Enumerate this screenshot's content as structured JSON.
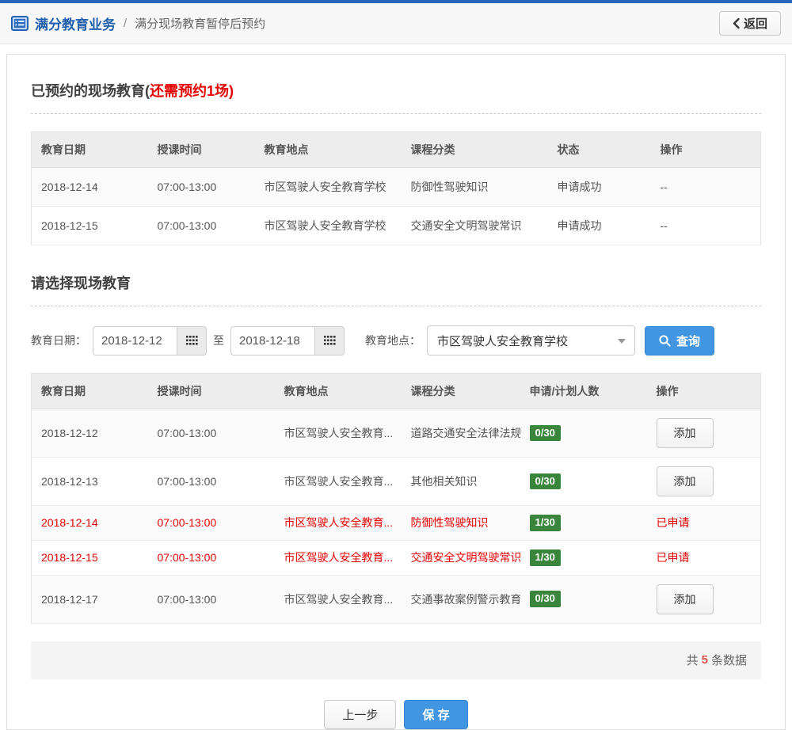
{
  "header": {
    "breadcrumb": {
      "root": "满分教育业务",
      "separator": "/",
      "current": "满分现场教育暂停后预约"
    },
    "back_label": "返回"
  },
  "booked": {
    "title_main": "已预约的现场教育(",
    "title_highlight": "还需预约1场",
    "title_close": ")",
    "table": {
      "headers": [
        "教育日期",
        "授课时间",
        "教育地点",
        "课程分类",
        "状态",
        "操作"
      ],
      "rows": [
        {
          "date": "2018-12-14",
          "time": "07:00-13:00",
          "location": "市区驾驶人安全教育学校",
          "course": "防御性驾驶知识",
          "status": "申请成功",
          "action": "--"
        },
        {
          "date": "2018-12-15",
          "time": "07:00-13:00",
          "location": "市区驾驶人安全教育学校",
          "course": "交通安全文明驾驶常识",
          "status": "申请成功",
          "action": "--"
        }
      ]
    }
  },
  "select": {
    "title": "请选择现场教育",
    "filters": {
      "date_label": "教育日期：",
      "date_from": "2018-12-12",
      "to_label": "至",
      "date_to": "2018-12-18",
      "location_label": "教育地点：",
      "location_value": "市区驾驶人安全教育学校",
      "search_label": "查询"
    },
    "table": {
      "headers": [
        "教育日期",
        "授课时间",
        "教育地点",
        "课程分类",
        "申请/计划人数",
        "操作"
      ],
      "rows": [
        {
          "date": "2018-12-12",
          "time": "07:00-13:00",
          "location": "市区驾驶人安全教育...",
          "course": "道路交通安全法律法规",
          "count": "0/30",
          "action": "添加",
          "applied": false
        },
        {
          "date": "2018-12-13",
          "time": "07:00-13:00",
          "location": "市区驾驶人安全教育...",
          "course": "其他相关知识",
          "count": "0/30",
          "action": "添加",
          "applied": false
        },
        {
          "date": "2018-12-14",
          "time": "07:00-13:00",
          "location": "市区驾驶人安全教育...",
          "course": "防御性驾驶知识",
          "count": "1/30",
          "action": "已申请",
          "applied": true
        },
        {
          "date": "2018-12-15",
          "time": "07:00-13:00",
          "location": "市区驾驶人安全教育...",
          "course": "交通安全文明驾驶常识",
          "count": "1/30",
          "action": "已申请",
          "applied": true
        },
        {
          "date": "2018-12-17",
          "time": "07:00-13:00",
          "location": "市区驾驶人安全教育...",
          "course": "交通事故案例警示教育",
          "count": "0/30",
          "action": "添加",
          "applied": false
        }
      ]
    },
    "footer": {
      "prefix": "共",
      "count": "5",
      "suffix": "条数据"
    }
  },
  "actions": {
    "prev_label": "上一步",
    "save_label": "保 存"
  },
  "colors": {
    "accent_blue": "#4195e1",
    "link_blue": "#2160ac",
    "topline_blue": "#2a64b6",
    "danger_red": "#e60000",
    "count_red": "#d9534f",
    "success_green": "#38853b"
  }
}
